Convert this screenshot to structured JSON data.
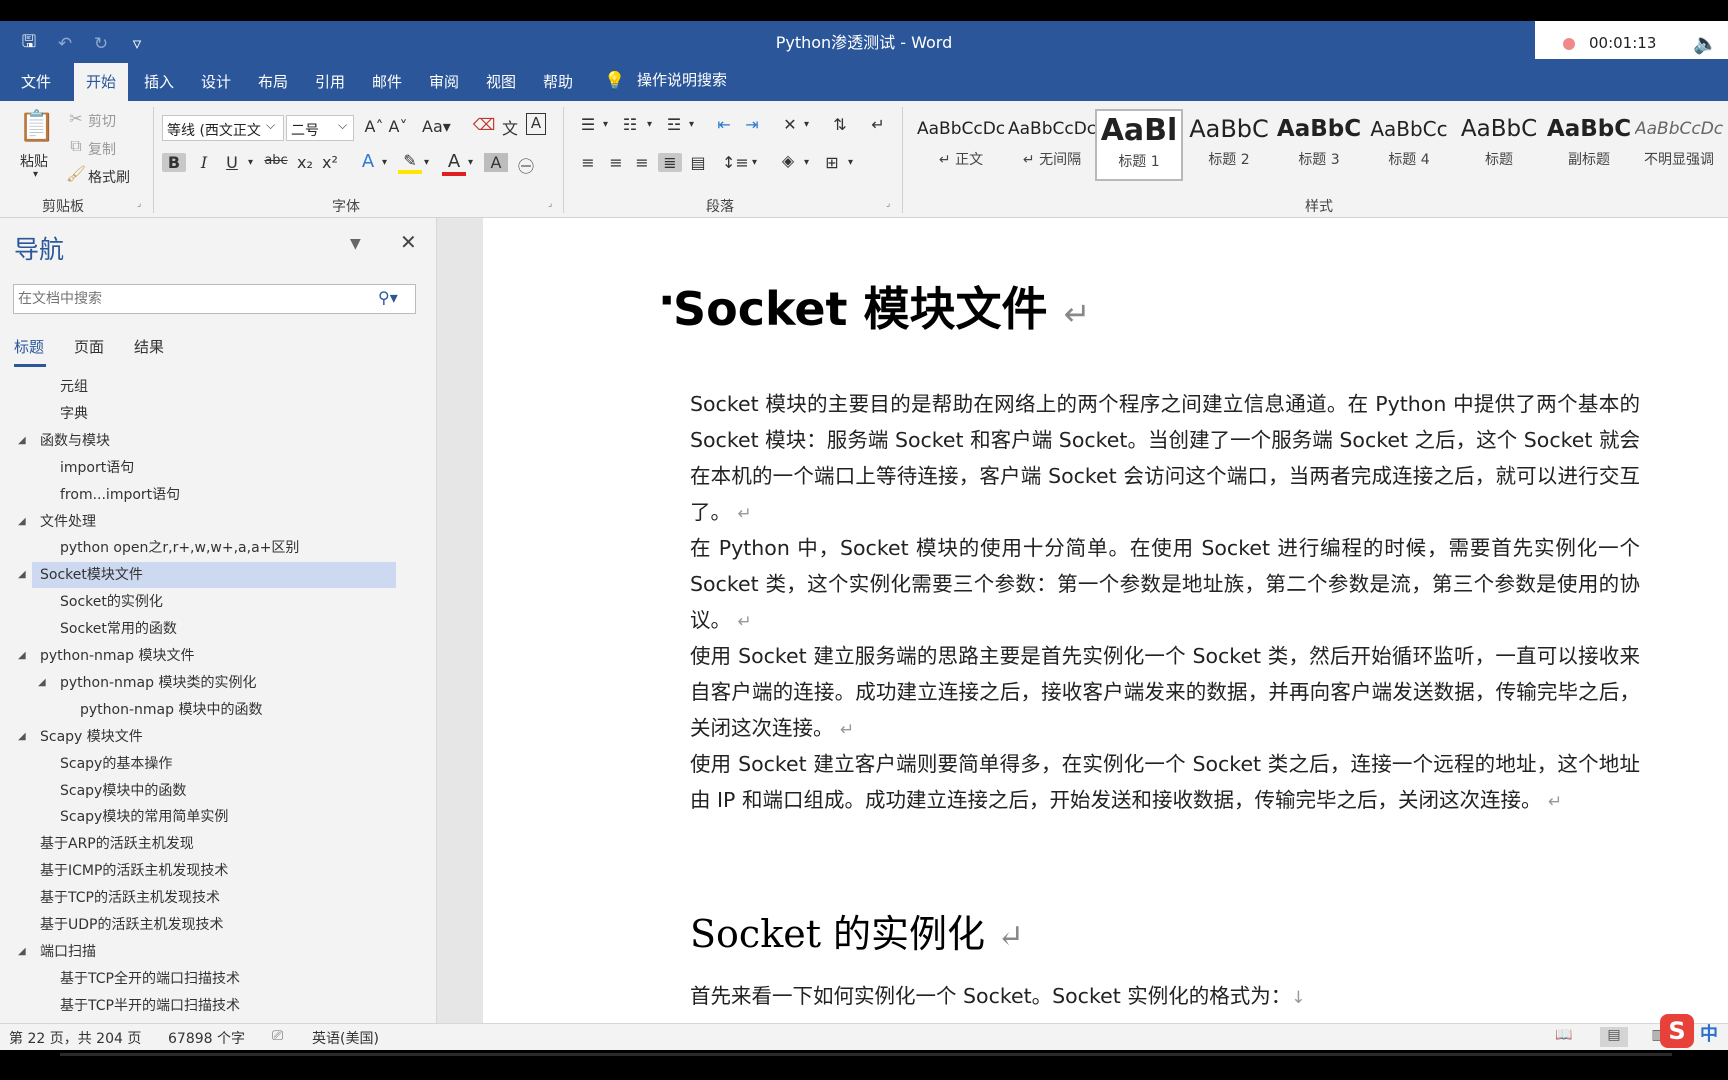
{
  "window": {
    "title": "Python渗透测试  -  Word",
    "recording_time": "00:01:13"
  },
  "menu": {
    "tabs": [
      "文件",
      "开始",
      "插入",
      "设计",
      "布局",
      "引用",
      "邮件",
      "审阅",
      "视图",
      "帮助"
    ],
    "active_tab": "开始",
    "tell_me": "操作说明搜索"
  },
  "ribbon": {
    "clipboard": {
      "paste": "粘贴",
      "cut": "剪切",
      "copy": "复制",
      "format_painter": "格式刷",
      "label": "剪贴板"
    },
    "font": {
      "font_name": "等线 (西文正文",
      "font_size": "二号",
      "label": "字体"
    },
    "paragraph": {
      "label": "段落"
    },
    "styles": {
      "label": "样式",
      "items": [
        {
          "sample": "AaBbCcDc",
          "name": "↵ 正文"
        },
        {
          "sample": "AaBbCcDc",
          "name": "↵ 无间隔"
        },
        {
          "sample": "AaBl",
          "name": "标题 1"
        },
        {
          "sample": "AaBbC",
          "name": "标题 2"
        },
        {
          "sample": "AaBbC",
          "name": "标题 3"
        },
        {
          "sample": "AaBbCc",
          "name": "标题 4"
        },
        {
          "sample": "AaBbC",
          "name": "标题"
        },
        {
          "sample": "AaBbC",
          "name": "副标题"
        },
        {
          "sample": "AaBbCcDc",
          "name": "不明显强调"
        }
      ]
    }
  },
  "navigation": {
    "title": "导航",
    "search_placeholder": "在文档中搜索",
    "tabs": [
      "标题",
      "页面",
      "结果"
    ],
    "items": [
      {
        "text": "元组",
        "level": 2,
        "expander": false,
        "selected": false
      },
      {
        "text": "字典",
        "level": 2,
        "expander": false,
        "selected": false
      },
      {
        "text": "函数与模块",
        "level": 1,
        "expander": true,
        "selected": false
      },
      {
        "text": "import语句",
        "level": 2,
        "expander": false,
        "selected": false
      },
      {
        "text": "from...import语句",
        "level": 2,
        "expander": false,
        "selected": false
      },
      {
        "text": "文件处理",
        "level": 1,
        "expander": true,
        "selected": false
      },
      {
        "text": "python open之r,r+,w,w+,a,a+区别",
        "level": 2,
        "expander": false,
        "selected": false
      },
      {
        "text": "Socket模块文件",
        "level": 1,
        "expander": true,
        "selected": true
      },
      {
        "text": "Socket的实例化",
        "level": 2,
        "expander": false,
        "selected": false
      },
      {
        "text": "Socket常用的函数",
        "level": 2,
        "expander": false,
        "selected": false
      },
      {
        "text": "python-nmap 模块文件",
        "level": 1,
        "expander": true,
        "selected": false
      },
      {
        "text": "python-nmap 模块类的实例化",
        "level": 2,
        "expander": true,
        "selected": false
      },
      {
        "text": "python-nmap 模块中的函数",
        "level": 3,
        "expander": false,
        "selected": false
      },
      {
        "text": "Scapy 模块文件",
        "level": 1,
        "expander": true,
        "selected": false
      },
      {
        "text": "Scapy的基本操作",
        "level": 2,
        "expander": false,
        "selected": false
      },
      {
        "text": "Scapy模块中的函数",
        "level": 2,
        "expander": false,
        "selected": false
      },
      {
        "text": "Scapy模块的常用简单实例",
        "level": 2,
        "expander": false,
        "selected": false
      },
      {
        "text": "基于ARP的活跃主机发现",
        "level": 1,
        "expander": false,
        "selected": false
      },
      {
        "text": "基于ICMP的活跃主机发现技术",
        "level": 1,
        "expander": false,
        "selected": false
      },
      {
        "text": "基于TCP的活跃主机发现技术",
        "level": 1,
        "expander": false,
        "selected": false
      },
      {
        "text": "基于UDP的活跃主机发现技术",
        "level": 1,
        "expander": false,
        "selected": false
      },
      {
        "text": "端口扫描",
        "level": 1,
        "expander": true,
        "selected": false
      },
      {
        "text": "基于TCP全开的端口扫描技术",
        "level": 2,
        "expander": false,
        "selected": false
      },
      {
        "text": "基于TCP半开的端口扫描技术",
        "level": 2,
        "expander": false,
        "selected": false
      }
    ]
  },
  "document": {
    "heading1": "Socket 模块文件",
    "paragraphs": [
      "Socket 模块的主要目的是帮助在网络上的两个程序之间建立信息通道。在 Python 中提供了两个基本的 Socket 模块：服务端 Socket 和客户端 Socket。当创建了一个服务端 Socket 之后，这个 Socket 就会在本机的一个端口上等待连接，客户端 Socket 会访问这个端口，当两者完成连接之后，就可以进行交互了。",
      "在 Python 中，Socket 模块的使用十分简单。在使用 Socket 进行编程的时候，需要首先实例化一个 Socket 类，这个实例化需要三个参数：第一个参数是地址族，第二个参数是流，第三个参数是使用的协议。",
      "使用 Socket 建立服务端的思路主要是首先实例化一个 Socket 类，然后开始循环监听，一直可以接收来自客户端的连接。成功建立连接之后，接收客户端发来的数据，并再向客户端发送数据，传输完毕之后，关闭这次连接。",
      "使用 Socket 建立客户端则要简单得多，在实例化一个 Socket 类之后，连接一个远程的地址，这个地址由 IP 和端口组成。成功建立连接之后，开始发送和接收数据，传输完毕之后，关闭这次连接。"
    ],
    "heading2": "Socket 的实例化",
    "last_line": "首先来看一下如何实例化一个 Socket。Socket 实例化的格式为：",
    "return_mark": "↵"
  },
  "statusbar": {
    "page": "第 22 页，共 204 页",
    "words": "67898 个字",
    "language": "英语(美国)"
  },
  "ime": {
    "logo": "S",
    "mode": "中"
  }
}
